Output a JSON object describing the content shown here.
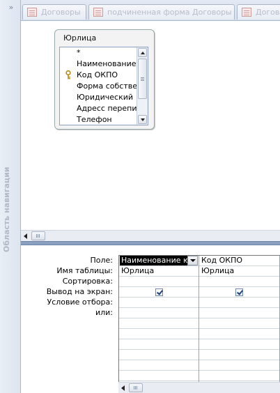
{
  "navigation_pane": {
    "toggle_glyph": "»",
    "title": "Область навигации"
  },
  "tabs": [
    {
      "label": "Договоры"
    },
    {
      "label": "подчиненная форма Договоры"
    },
    {
      "label": "Догово"
    }
  ],
  "table_box": {
    "title": "Юрлица",
    "fields": [
      {
        "label": "*",
        "is_key": false
      },
      {
        "label": "Наименование",
        "is_key": false
      },
      {
        "label": "Код ОКПО",
        "is_key": true
      },
      {
        "label": "Форма собстве",
        "is_key": false
      },
      {
        "label": "Юридический",
        "is_key": false
      },
      {
        "label": "Адресс перепи",
        "is_key": false
      },
      {
        "label": "Телефон",
        "is_key": false
      }
    ]
  },
  "design_grid": {
    "row_labels": [
      "Поле:",
      "Имя таблицы:",
      "Сортировка:",
      "Вывод на экран:",
      "Условие отбора:",
      "или:"
    ],
    "columns": [
      {
        "field": "Наименование ю",
        "table": "Юрлица",
        "sort": "",
        "show": true,
        "criteria": "",
        "or": ""
      },
      {
        "field": "Код ОКПО",
        "table": "Юрлица",
        "sort": "",
        "show": true,
        "criteria": "",
        "or": ""
      }
    ]
  },
  "colors": {
    "nav_bg": "#e3e9f3",
    "splitter": "#8aa0c0",
    "selected_cell_bg": "#000000",
    "key_icon": "#d4a000"
  }
}
